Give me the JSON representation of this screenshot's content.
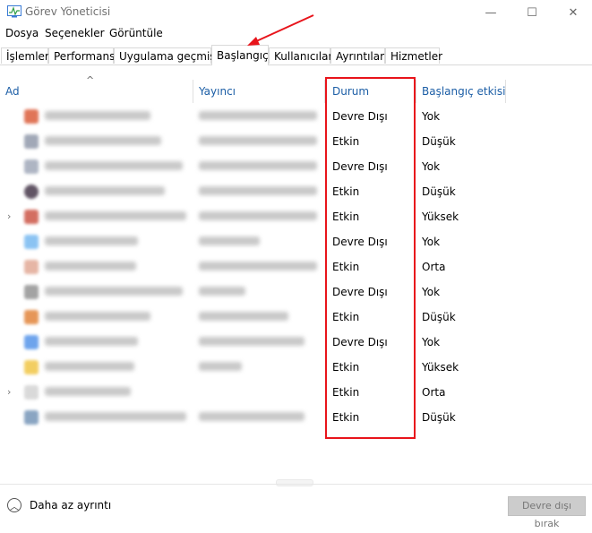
{
  "window": {
    "title": "Görev Yöneticisi",
    "minimize": "—",
    "maximize": "☐",
    "close": "✕"
  },
  "menu": [
    {
      "label": "Dosya"
    },
    {
      "label": "Seçenekler"
    },
    {
      "label": "Görüntüle"
    }
  ],
  "tabs": [
    {
      "label": "İşlemler"
    },
    {
      "label": "Performans"
    },
    {
      "label": "Uygulama geçmişi"
    },
    {
      "label": "Başlangıç"
    },
    {
      "label": "Kullanıcılar"
    },
    {
      "label": "Ayrıntılar"
    },
    {
      "label": "Hizmetler"
    }
  ],
  "columns": {
    "name": "Ad",
    "publisher": "Yayıncı",
    "status": "Durum",
    "impact": "Başlangıç etkisi",
    "sort_caret": "^"
  },
  "rows": [
    {
      "status": "Devre Dışı",
      "impact": "Yok"
    },
    {
      "status": "Etkin",
      "impact": "Düşük"
    },
    {
      "status": "Devre Dışı",
      "impact": "Yok"
    },
    {
      "status": "Etkin",
      "impact": "Düşük"
    },
    {
      "status": "Etkin",
      "impact": "Yüksek"
    },
    {
      "status": "Devre Dışı",
      "impact": "Yok"
    },
    {
      "status": "Etkin",
      "impact": "Orta"
    },
    {
      "status": "Devre Dışı",
      "impact": "Yok"
    },
    {
      "status": "Etkin",
      "impact": "Düşük"
    },
    {
      "status": "Devre Dışı",
      "impact": "Yok"
    },
    {
      "status": "Etkin",
      "impact": "Yüksek"
    },
    {
      "status": "Etkin",
      "impact": "Orta"
    },
    {
      "status": "Etkin",
      "impact": "Düşük"
    }
  ],
  "footer": {
    "less_details": "Daha az ayrıntı",
    "disable_button": "Devre dışı bırak"
  },
  "colors": {
    "annotation_red": "#e8141b",
    "header_blue": "#1c5ea6"
  }
}
